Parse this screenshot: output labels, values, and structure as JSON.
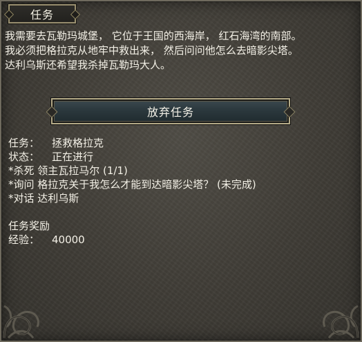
{
  "window": {
    "title": "任务"
  },
  "description": {
    "lines": [
      "我需要去瓦勒玛城堡， 它位于王国的西海岸， 红石海湾的南部。",
      "我必须把格拉克从地牢中救出来， 然后问问他怎么去暗影尖塔。",
      "达利乌斯还希望我杀掉瓦勒玛大人。"
    ]
  },
  "buttons": {
    "abandon_label": "放弃任务"
  },
  "quest": {
    "name_key": "任务：",
    "name_value": "拯救格拉克",
    "status_key": "状态：",
    "status_value": "正在进行",
    "objectives": [
      "*杀死 领主瓦拉马尔 (1/1)",
      "*询问 格拉克关于我怎么才能到达暗影尖塔？ (未完成)",
      "*对话 达利乌斯"
    ]
  },
  "rewards": {
    "heading": "任务奖励",
    "xp_key": "经验：",
    "xp_value": "40000"
  },
  "colors": {
    "text": "#f3f0e6",
    "panel_bg": "#45423c",
    "border_gold": "#b5ab88",
    "button_bg": "#2b383d"
  },
  "icons": {
    "corner_decoration": "celtic-knot-icon"
  }
}
